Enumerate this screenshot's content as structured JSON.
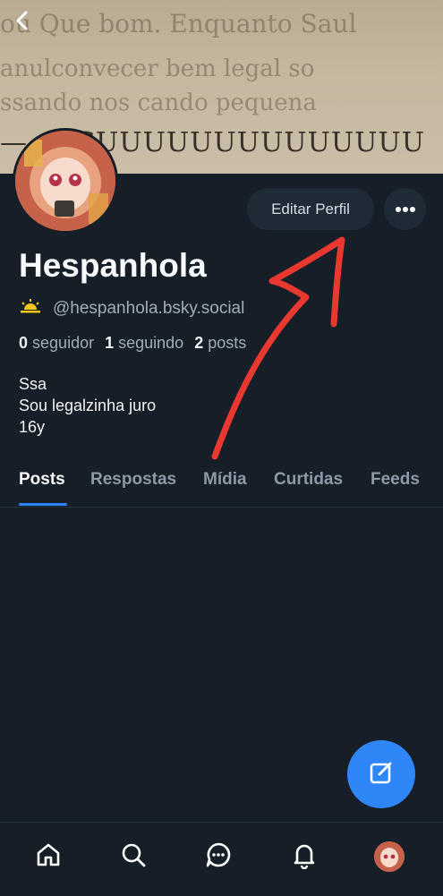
{
  "banner": {
    "text_rows": [
      "ou Que bom. Enquanto Saul",
      "anulconvecer bem legal so",
      "ssando nos cando pequena",
      "— — CUUUUUUUUUUUUUU"
    ]
  },
  "profile": {
    "display_name": "Hespanhola",
    "handle": "@hespanhola.bsky.social",
    "handle_icon": "sun-rise-emoji",
    "edit_label": "Editar Perfil",
    "stats": {
      "followers_count": "0",
      "followers_label": "seguidor",
      "following_count": "1",
      "following_label": "seguindo",
      "posts_count": "2",
      "posts_label": "posts"
    },
    "bio": [
      "Ssa",
      "Sou legalzinha juro",
      "16y"
    ]
  },
  "tabs": [
    {
      "label": "Posts",
      "active": true
    },
    {
      "label": "Respostas",
      "active": false
    },
    {
      "label": "Mídia",
      "active": false
    },
    {
      "label": "Curtidas",
      "active": false
    },
    {
      "label": "Feeds",
      "active": false
    }
  ],
  "bottom_nav": [
    "home-icon",
    "search-icon",
    "chat-icon",
    "bell-icon",
    "profile-avatar"
  ],
  "colors": {
    "background": "#161e27",
    "accent": "#2a86f3",
    "fab": "#2f86f6",
    "annotation": "#e8382f"
  }
}
